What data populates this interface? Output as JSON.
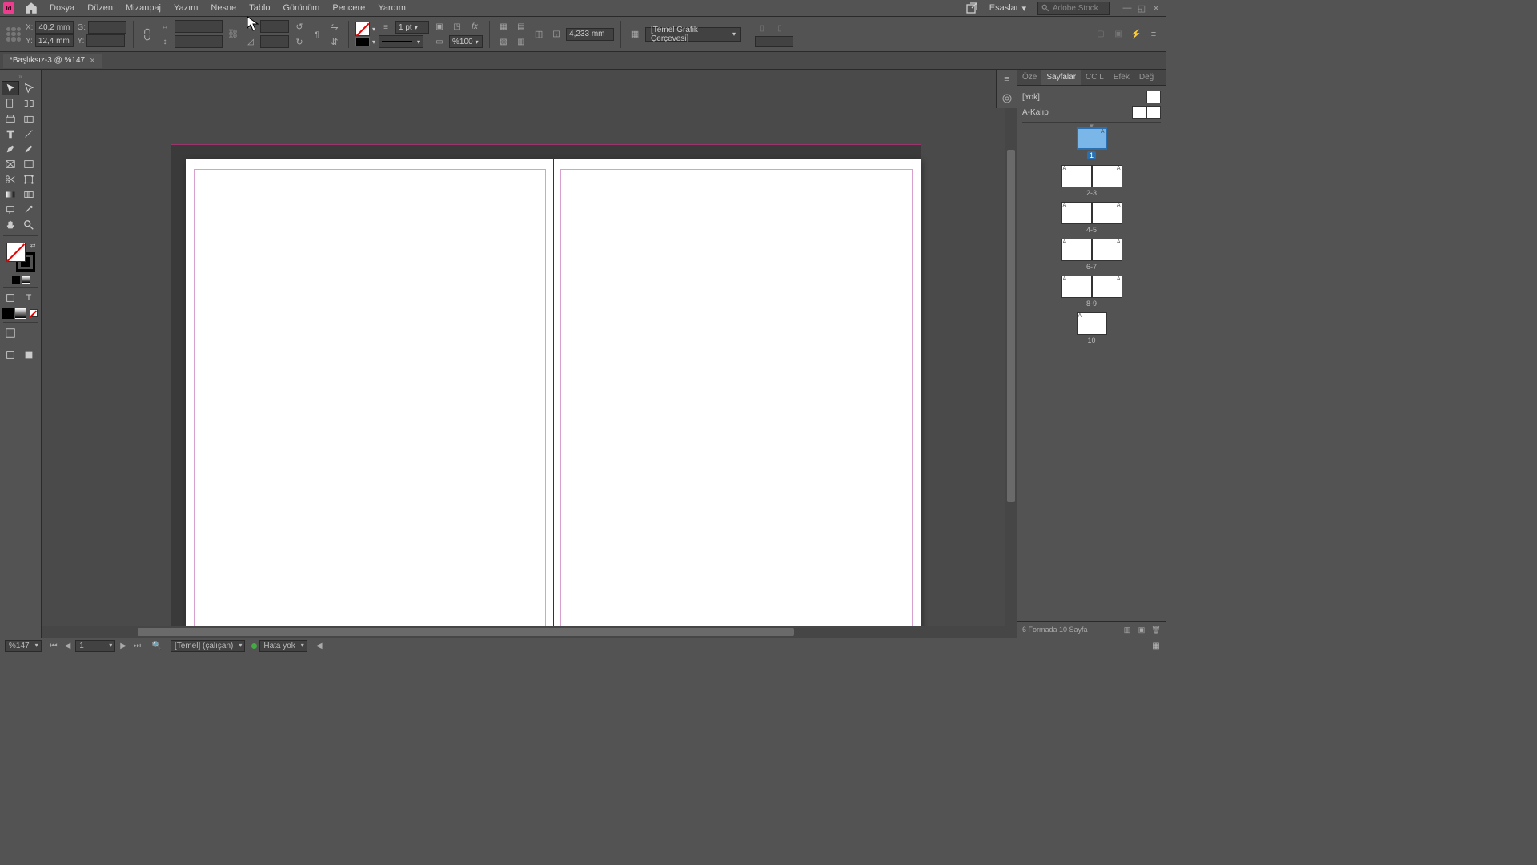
{
  "app": {
    "logo": "Id"
  },
  "menubar": {
    "items": [
      "Dosya",
      "Düzen",
      "Mizanpaj",
      "Yazım",
      "Nesne",
      "Tablo",
      "Görünüm",
      "Pencere",
      "Yardım"
    ],
    "workspace": "Esaslar",
    "search_placeholder": "Adobe Stock"
  },
  "controlbar": {
    "x_label": "X:",
    "x_value": "40,2 mm",
    "y_label": "Y:",
    "y_value": "12,4 mm",
    "w_label": "G:",
    "h_label": "Y:",
    "stroke_weight": "1 pt",
    "measure": "4,233 mm",
    "opacity_pct": "%100",
    "style": "[Temel Grafik Çerçevesi]"
  },
  "tab": {
    "title": "*Başlıksız-3 @ %147"
  },
  "statusbar": {
    "zoom": "%147",
    "page": "1",
    "preflight_profile": "[Temel] (çalışan)",
    "preflight_status": "Hata yok"
  },
  "panels": {
    "tabs": [
      "Öze",
      "Sayfalar",
      "CC L",
      "Efek",
      "Değ"
    ],
    "active_tab": "Sayfalar",
    "none_master": "[Yok]",
    "a_master": "A-Kalıp",
    "page_labels": [
      "1",
      "2-3",
      "4-5",
      "6-7",
      "8-9",
      "10"
    ],
    "footer_text": "6 Formada 10 Sayfa"
  }
}
